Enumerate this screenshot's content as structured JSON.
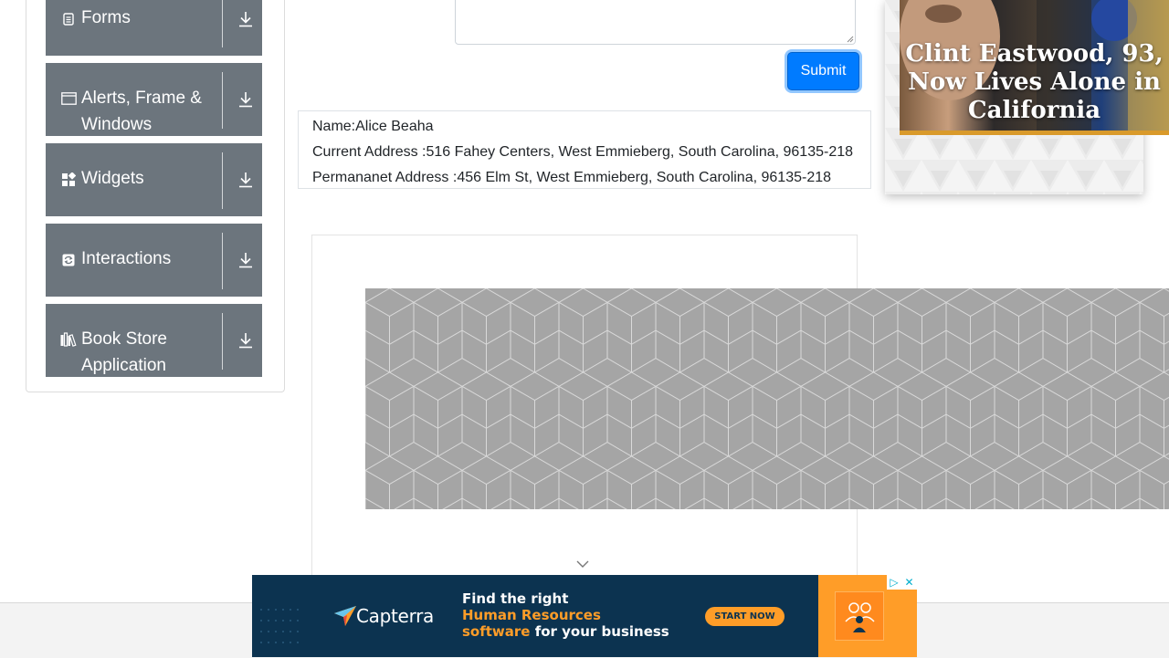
{
  "sidebar": {
    "groups": [
      {
        "label": "Forms",
        "icon": "form-icon"
      },
      {
        "label": "Alerts, Frame & Windows",
        "icon": "window-icon"
      },
      {
        "label": "Widgets",
        "icon": "widgets-icon"
      },
      {
        "label": "Interactions",
        "icon": "interactions-icon"
      },
      {
        "label": "Book Store Application",
        "icon": "books-icon"
      }
    ]
  },
  "form": {
    "submit_label": "Submit"
  },
  "output": {
    "name": "Name:Alice Beaha",
    "current_address": "Current Address :516 Fahey Centers, West Emmieberg, South Carolina, 96135-218",
    "permanent_address": "Permananet Address :456 Elm St, West Emmieberg, South Carolina, 96135-218"
  },
  "ad_right": {
    "headline": "Clint Eastwood, 93, Now Lives Alone in California"
  },
  "ad_bottom": {
    "brand": "Capterra",
    "line1": "Find the right",
    "line2": "Human Resources",
    "line3_highlight": "software",
    "line3_rest": " for your business",
    "cta": "START NOW"
  },
  "colors": {
    "sidebar_group_bg": "#6c757d",
    "submit_bg": "#007bff",
    "ad_bottom_bg": "#0c3350",
    "ad_bottom_accent": "#ff9d28"
  }
}
